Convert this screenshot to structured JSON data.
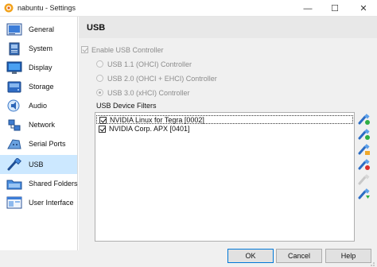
{
  "window": {
    "title": "nabuntu - Settings",
    "minimize_glyph": "—",
    "maximize_glyph": "☐",
    "close_glyph": "✕"
  },
  "sidebar": {
    "items": [
      {
        "label": "General",
        "icon": "general-icon"
      },
      {
        "label": "System",
        "icon": "system-chip-icon"
      },
      {
        "label": "Display",
        "icon": "display-monitor-icon"
      },
      {
        "label": "Storage",
        "icon": "storage-disk-icon"
      },
      {
        "label": "Audio",
        "icon": "audio-speaker-icon"
      },
      {
        "label": "Network",
        "icon": "network-icon"
      },
      {
        "label": "Serial Ports",
        "icon": "serial-port-icon"
      },
      {
        "label": "USB",
        "icon": "usb-icon",
        "selected": true
      },
      {
        "label": "Shared Folders",
        "icon": "shared-folder-icon"
      },
      {
        "label": "User Interface",
        "icon": "user-interface-icon"
      }
    ]
  },
  "main": {
    "title": "USB",
    "enable_usb": {
      "label": "Enable USB Controller",
      "checked": true,
      "disabled": true
    },
    "controllers": [
      {
        "label": "USB 1.1 (OHCI) Controller",
        "selected": false
      },
      {
        "label": "USB 2.0 (OHCI + EHCI) Controller",
        "selected": false
      },
      {
        "label": "USB 3.0 (xHCI) Controller",
        "selected": true
      }
    ],
    "filters_label": "USB Device Filters",
    "filters": [
      {
        "label": "NVIDIA Linux for Tegra [0002]",
        "checked": true
      },
      {
        "label": "NVIDIA Corp. APX [0401]",
        "checked": true
      }
    ]
  },
  "buttons": {
    "ok": "OK",
    "cancel": "Cancel",
    "help": "Help"
  },
  "colors": {
    "selected_nav": "#cce8ff",
    "accent": "#0078d7",
    "panel": "#f0f0f0"
  }
}
